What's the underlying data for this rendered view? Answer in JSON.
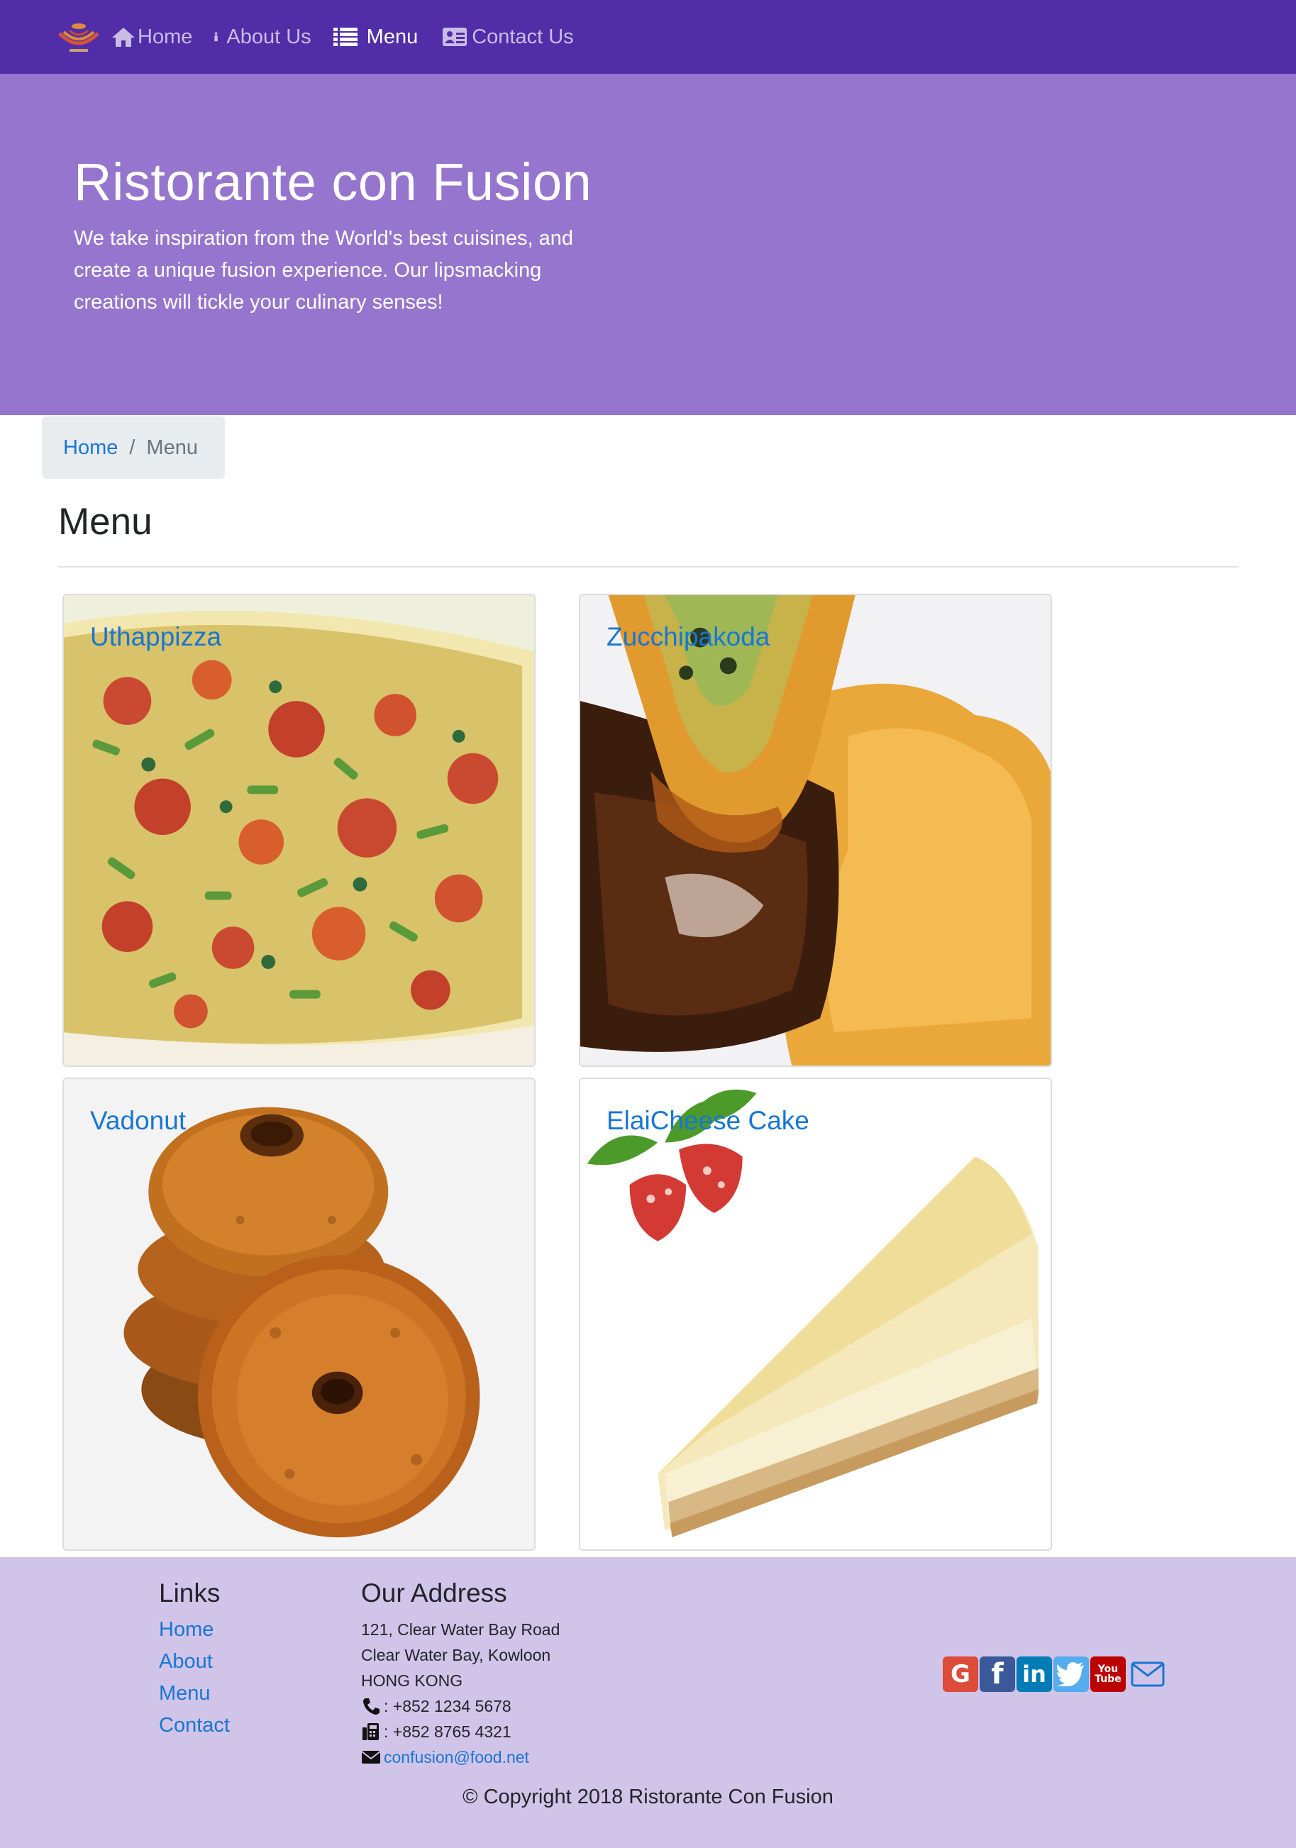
{
  "nav": {
    "brand_alt": "Ristorante Con Fusion logo",
    "items": [
      {
        "label": "Home",
        "icon": "home-icon"
      },
      {
        "label": "About Us",
        "icon": "info-icon"
      },
      {
        "label": "Menu",
        "icon": "list-icon"
      },
      {
        "label": "Contact Us",
        "icon": "address-card-icon"
      }
    ],
    "active": "Menu"
  },
  "jumbotron": {
    "title": "Ristorante con Fusion",
    "text": "We take inspiration from the World's best cuisines, and create a unique fusion experience. Our lipsmacking creations will tickle your culinary senses!"
  },
  "breadcrumb": {
    "items": [
      "Home",
      "Menu"
    ],
    "separator": "/"
  },
  "page": {
    "title": "Menu"
  },
  "menu": [
    {
      "name": "Uthappizza"
    },
    {
      "name": "Zucchipakoda"
    },
    {
      "name": "Vadonut"
    },
    {
      "name": "ElaiCheese Cake"
    }
  ],
  "footer": {
    "links_heading": "Links",
    "links": [
      "Home",
      "About",
      "Menu",
      "Contact"
    ],
    "address_heading": "Our Address",
    "address_lines": [
      "121, Clear Water Bay Road",
      "Clear Water Bay, Kowloon",
      "HONG KONG"
    ],
    "phone": ": +852 1234 5678",
    "fax": ": +852 8765 4321",
    "email": "confusion@food.net",
    "social": [
      {
        "name": "google-plus-icon",
        "glyph": "G",
        "color": "#dd4b39"
      },
      {
        "name": "facebook-icon",
        "glyph": "f",
        "color": "#3b5998"
      },
      {
        "name": "linkedin-icon",
        "glyph": "in",
        "color": "#007bb5"
      },
      {
        "name": "twitter-icon",
        "glyph": "t",
        "color": "#55acee"
      },
      {
        "name": "youtube-icon",
        "glyph": "You Tube",
        "color": "#bb0000"
      }
    ],
    "copyright": "© Copyright 2018 Ristorante Con Fusion"
  },
  "colors": {
    "primary": "#512DA8",
    "jumbotron": "#9575CD",
    "footer": "#D1C4E9",
    "link": "#1976d2"
  }
}
